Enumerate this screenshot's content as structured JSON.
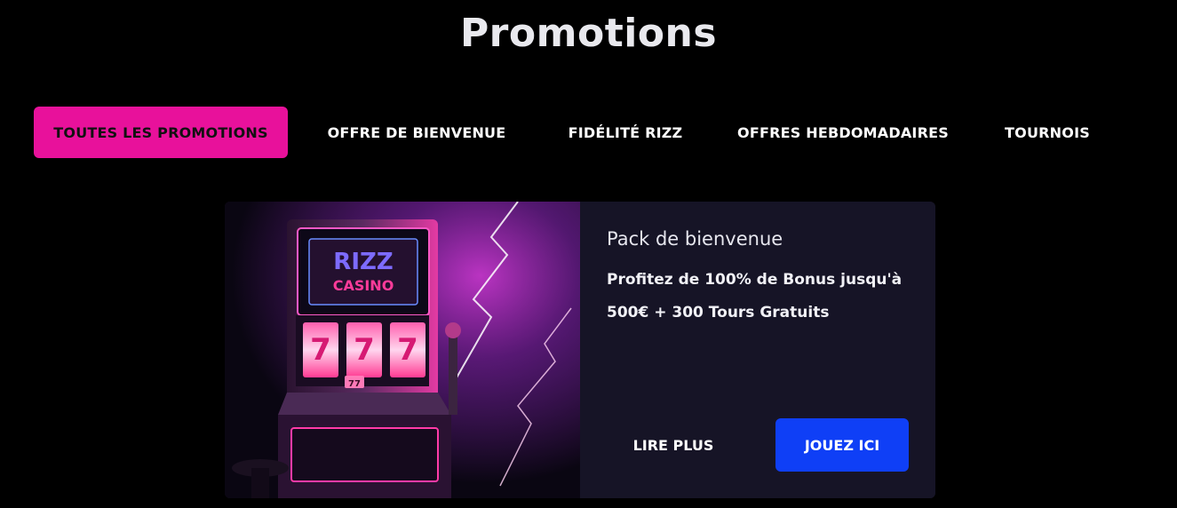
{
  "page": {
    "title": "Promotions"
  },
  "tabs": [
    {
      "label": "TOUTES LES PROMOTIONS",
      "active": true
    },
    {
      "label": "OFFRE DE BIENVENUE",
      "active": false
    },
    {
      "label": "FIDÉLITÉ RIZZ",
      "active": false
    },
    {
      "label": "OFFRES HEBDOMADAIRES",
      "active": false
    },
    {
      "label": "TOURNOIS",
      "active": false
    }
  ],
  "promo": {
    "label": "Pack de bienvenue",
    "description_line1": "Profitez de 100% de Bonus jusqu'à",
    "description_line2": "500€ + 300 Tours Gratuits",
    "image": {
      "sign_line1": "RIZZ",
      "sign_line2": "CASINO",
      "reels": [
        "7",
        "7",
        "7"
      ],
      "badge": "77"
    },
    "read_more_label": "LIRE PLUS",
    "play_label": "JOUEZ ICI"
  },
  "colors": {
    "background": "#000000",
    "accent_pink": "#e8119b",
    "accent_blue": "#0f3ff6",
    "card_bg": "#161426"
  }
}
